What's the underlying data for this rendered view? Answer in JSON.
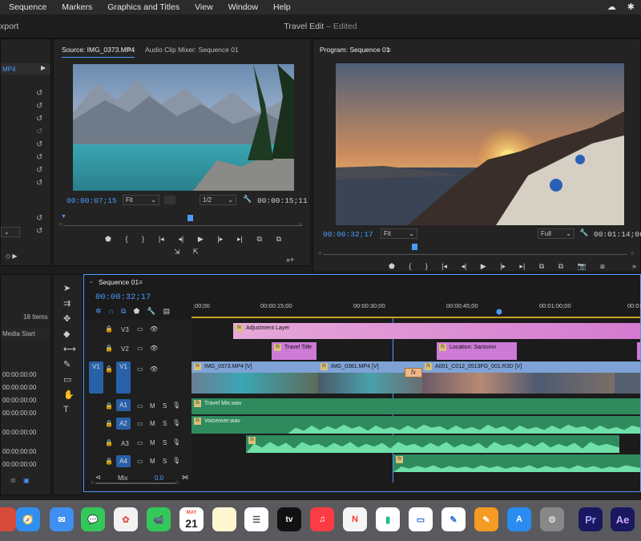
{
  "menubar": {
    "items": [
      "Sequence",
      "Markers",
      "Graphics and Titles",
      "View",
      "Window",
      "Help"
    ]
  },
  "window": {
    "title": "Travel Edit",
    "edited": " – Edited",
    "export_label": "xport"
  },
  "project": {
    "tab": "MP4",
    "items_count": "18 Items",
    "column": "Media Start",
    "timecodes": [
      "00:00:00:00",
      "00:00:00:00",
      "00:00:00:00",
      "00:00:00:00",
      "00:00:00:00",
      "00:00:00:00",
      "00:00:00:00"
    ]
  },
  "source": {
    "tab": "Source: IMG_0373.MP4",
    "tab2": "Audio Clip Mixer: Sequence 01",
    "timecode": "00:00:07;15",
    "fit": "Fit",
    "resolution": "1/2",
    "duration": "00:00:15;11",
    "playhead": 0.53
  },
  "program": {
    "tab": "Program: Sequence 01",
    "timecode": "00:00:32;17",
    "fit": "Fit",
    "resolution": "Full",
    "duration": "00:01:14;06",
    "playhead": 0.3
  },
  "timeline": {
    "tab": "Sequence 01",
    "timecode": "00:00:32;17",
    "ruler": [
      ";00;00",
      "00:00:15;00",
      "00:00:30;00",
      "00:00:45;00",
      "00:01:00;00",
      "00:01:1"
    ],
    "tracks": {
      "v3": "V3",
      "v2": "V2",
      "v1": "V1",
      "v1src": "V1",
      "a1": "A1",
      "a2": "A2",
      "a3": "A3",
      "a4": "A4",
      "mix": "Mix",
      "mix_val": "0.0"
    },
    "clips": {
      "adjustment": "Adjustment Layer",
      "travel_title": "Travel Title",
      "location": "Location: Santorini",
      "v1a": "IMG_0373.MP4 [V]",
      "v1b": "IMG_0381.MP4 [V]",
      "v1c": "A001_C012_0513FG_001.R3D [V]",
      "a1": "Travel Mix.wav",
      "a2": "Voiceover.wav"
    },
    "ms_labels": [
      "M",
      "S",
      "M",
      "S",
      "M",
      "S",
      "M",
      "S"
    ]
  },
  "dock": {
    "calendar_month": "MAY",
    "calendar_day": "21",
    "tv": "tv",
    "pr": "Pr",
    "ae": "Ae"
  },
  "colors": {
    "accent": "#4b9bff",
    "adjustment": "#d48ad4",
    "title": "#d07bd8",
    "video": "#7fa3d6",
    "audio": "#3e9a6a"
  }
}
